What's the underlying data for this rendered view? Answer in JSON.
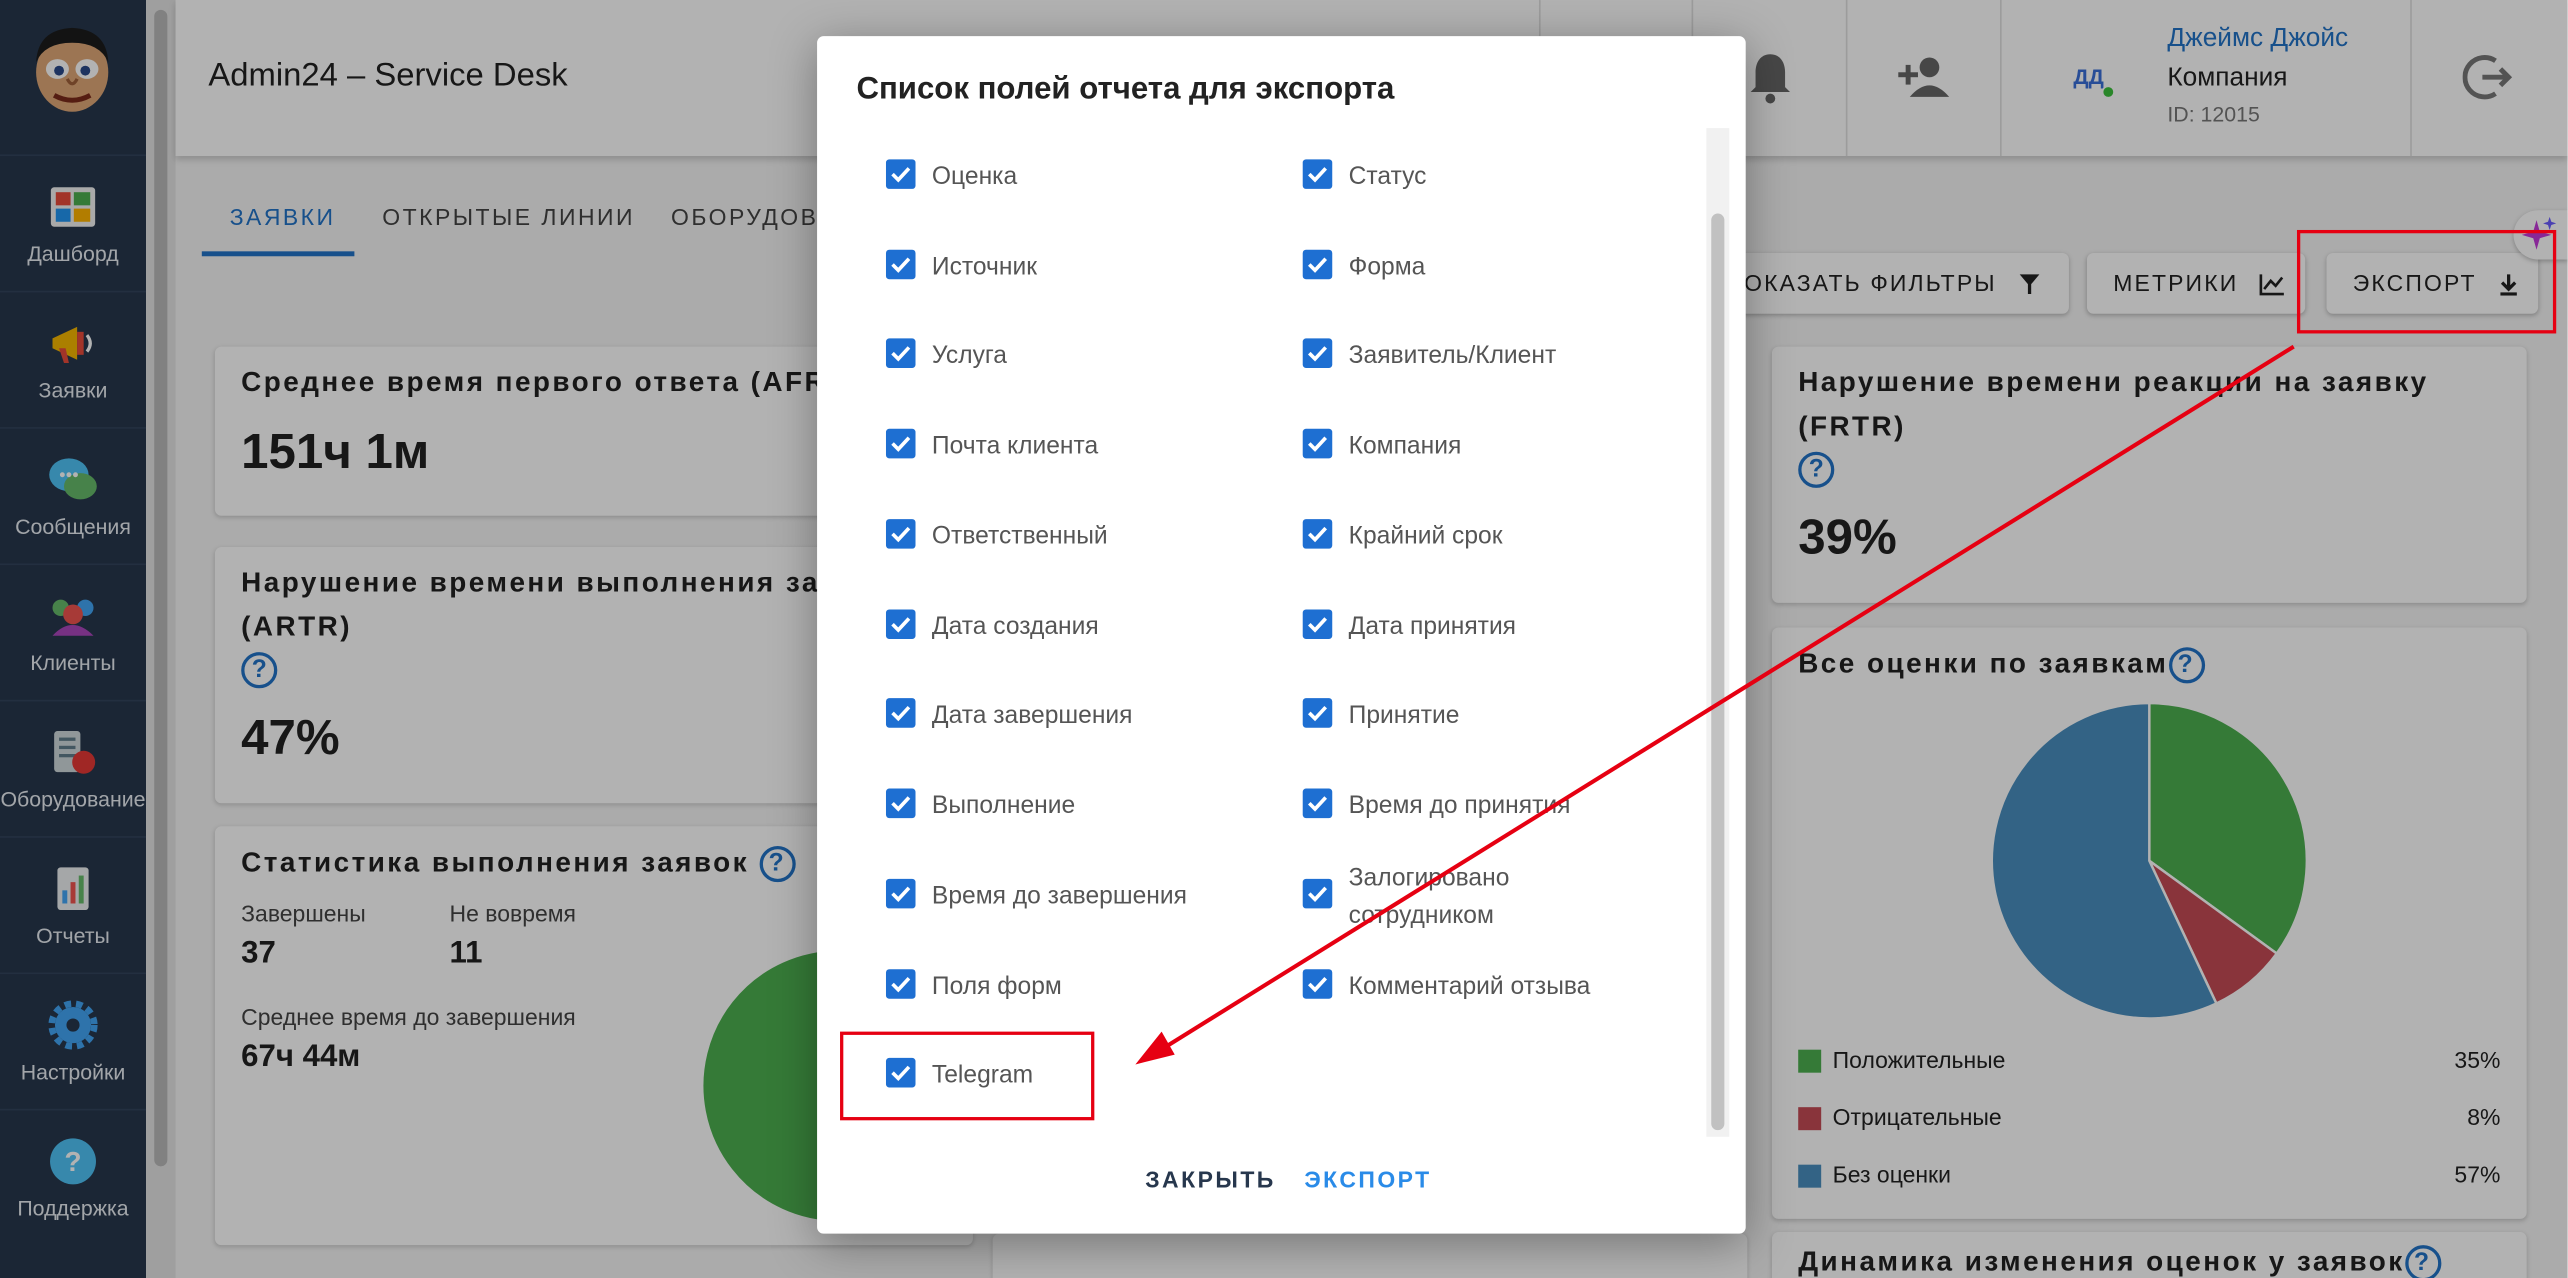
{
  "app": {
    "title": "Admin24 – Service Desk"
  },
  "sidebar": {
    "items": [
      {
        "label": "Дашборд",
        "icon": "dashboard-icon"
      },
      {
        "label": "Заявки",
        "icon": "megaphone-icon"
      },
      {
        "label": "Сообщения",
        "icon": "chat-icon"
      },
      {
        "label": "Клиенты",
        "icon": "clients-icon"
      },
      {
        "label": "Оборудование",
        "icon": "equipment-icon"
      },
      {
        "label": "Отчеты",
        "icon": "reports-icon"
      },
      {
        "label": "Настройки",
        "icon": "gear-icon"
      },
      {
        "label": "Поддержка",
        "icon": "help-icon"
      }
    ]
  },
  "user": {
    "initials": "ДД",
    "name": "Джеймс Джойс",
    "company": "Компания",
    "id": "ID: 12015"
  },
  "tabs": [
    "ЗАЯВКИ",
    "ОТКРЫТЫЕ ЛИНИИ",
    "ОБОРУДОВА"
  ],
  "toolbar": {
    "filters_label": "ОКАЗАТЬ ФИЛЬТРЫ",
    "metrics_label": "МЕТРИКИ",
    "export_label": "ЭКСПОРТ"
  },
  "cards": {
    "afrt": {
      "title": "Среднее время первого ответа (AFR",
      "value": "151ч 1м"
    },
    "artr": {
      "title_line1": "Нарушение времени выполнения за",
      "title_line2": "(ARTR)",
      "value": "47%"
    },
    "stats": {
      "title": "Статистика выполнения заявок",
      "completed_label": "Завершены",
      "completed_value": "37",
      "late_label": "Не вовремя",
      "late_value": "11",
      "avg_label": "Среднее время до завершения",
      "avg_value": "67ч 44м"
    },
    "frtr": {
      "title_line1": "Нарушение времени реакции на заявку",
      "title_line2": "(FRTR)",
      "value": "39%"
    },
    "ratings": {
      "title": "Все оценки по заявкам"
    },
    "dynamics": {
      "title": "Динамика изменения оценок у заявок"
    }
  },
  "chart_data": [
    {
      "type": "pie",
      "title": "Все оценки по заявкам",
      "categories": [
        "Положительные",
        "Отрицательные",
        "Без оценки"
      ],
      "values": [
        35,
        8,
        57
      ],
      "labels": [
        "35%",
        "8%",
        "57%"
      ],
      "colors": [
        "#4caf50",
        "#c44b55",
        "#4a8fbf"
      ],
      "legend": "bottom"
    },
    {
      "type": "pie",
      "title": "Статистика выполнения заявок",
      "categories": [
        "",
        "",
        ""
      ],
      "values": [
        45,
        30,
        3
      ],
      "colors": [
        "#4caf50",
        "#c44b55",
        "#e0a040"
      ],
      "legend": "none"
    }
  ],
  "dialog": {
    "title": "Список полей отчета для экспорта",
    "left_fields": [
      "Оценка",
      "Источник",
      "Услуга",
      "Почта клиента",
      "Ответственный",
      "Дата создания",
      "Дата завершения",
      "Выполнение",
      "Время до завершения",
      "Поля форм",
      "Telegram"
    ],
    "right_fields": [
      "Статус",
      "Форма",
      "Заявитель/Клиент",
      "Компания",
      "Крайний срок",
      "Дата принятия",
      "Принятие",
      "Время до принятия",
      "Залогировано сотрудником",
      "Комментарий отзыва"
    ],
    "close_label": "ЗАКРЫТЬ",
    "export_label": "ЭКСПОРТ"
  },
  "colors": {
    "accent": "#2273c7",
    "sidebar": "#27374d",
    "checkbox": "#1e6fd2",
    "highlight": "#e60012"
  }
}
